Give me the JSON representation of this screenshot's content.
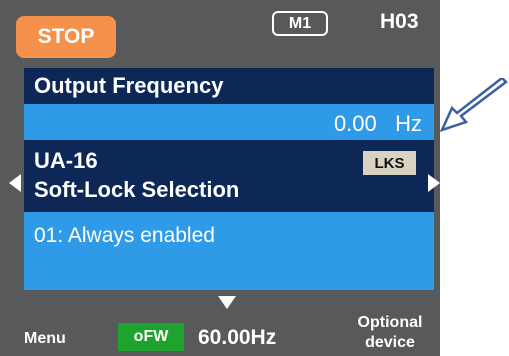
{
  "status": {
    "label": "STOP",
    "color": "#f5914b"
  },
  "header": {
    "mode": "M1",
    "code": "H03"
  },
  "monitor": {
    "title": "Output Frequency",
    "value": "0.00",
    "unit": "Hz"
  },
  "parameter": {
    "code": "UA-16",
    "name": "Soft-Lock Selection",
    "tag": "LKS"
  },
  "setting": {
    "value": "01: Always enabled"
  },
  "footer": {
    "menu": "Menu",
    "source_badge": "oFW",
    "frequency": "60.00Hz",
    "optional_line1": "Optional",
    "optional_line2": "device"
  },
  "icons": {
    "left": "nav-left-arrow-icon",
    "right": "nav-right-arrow-icon",
    "down": "scroll-down-arrow-icon",
    "callout": "callout-arrow-icon"
  }
}
